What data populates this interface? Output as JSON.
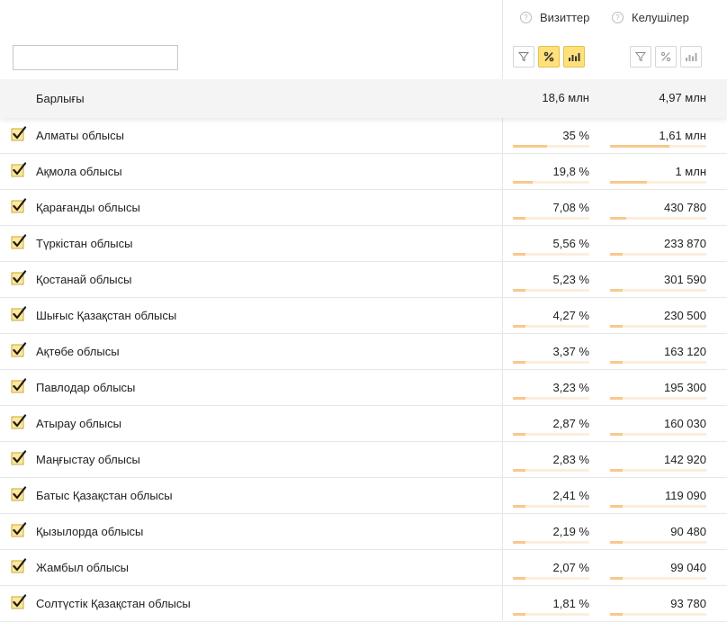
{
  "colors": {
    "accent": "#ffe07a",
    "bar": "#f7c98c",
    "bar_track": "#fbeedc",
    "check": "#1a1a1a",
    "check_bg": "#ffe89a"
  },
  "header": {
    "search_placeholder": "",
    "columns": [
      {
        "label": "Визиттер",
        "help_icon": "help-icon"
      },
      {
        "label": "Келушілер",
        "help_icon": "help-icon"
      }
    ],
    "buttons": {
      "visits": {
        "filter_active": false,
        "percent_active": true,
        "bars_active": true
      },
      "users": {
        "filter_active": false,
        "percent_active": false,
        "bars_active": false
      }
    }
  },
  "total": {
    "label": "Барлығы",
    "visits": "18,6 млн",
    "users": "4,97 млн"
  },
  "rows": [
    {
      "label": "Алматы облысы",
      "visits": "35 %",
      "users": "1,61 млн",
      "visits_share": 0.35,
      "users_share": 0.324,
      "checked": true
    },
    {
      "label": "Ақмола облысы",
      "visits": "19,8 %",
      "users": "1 млн",
      "visits_share": 0.198,
      "users_share": 0.201,
      "checked": true
    },
    {
      "label": "Қарағанды облысы",
      "visits": "7,08 %",
      "users": "430 780",
      "visits_share": 0.0708,
      "users_share": 0.0867,
      "checked": true
    },
    {
      "label": "Түркістан облысы",
      "visits": "5,56 %",
      "users": "233 870",
      "visits_share": 0.0556,
      "users_share": 0.047,
      "checked": true
    },
    {
      "label": "Қостанай облысы",
      "visits": "5,23 %",
      "users": "301 590",
      "visits_share": 0.0523,
      "users_share": 0.0607,
      "checked": true
    },
    {
      "label": "Шығыс Қазақстан облысы",
      "visits": "4,27 %",
      "users": "230 500",
      "visits_share": 0.0427,
      "users_share": 0.0464,
      "checked": true
    },
    {
      "label": "Ақтөбе облысы",
      "visits": "3,37 %",
      "users": "163 120",
      "visits_share": 0.0337,
      "users_share": 0.0328,
      "checked": true
    },
    {
      "label": "Павлодар облысы",
      "visits": "3,23 %",
      "users": "195 300",
      "visits_share": 0.0323,
      "users_share": 0.0393,
      "checked": true
    },
    {
      "label": "Атырау облысы",
      "visits": "2,87 %",
      "users": "160 030",
      "visits_share": 0.0287,
      "users_share": 0.0322,
      "checked": true
    },
    {
      "label": "Маңғыстау облысы",
      "visits": "2,83 %",
      "users": "142 920",
      "visits_share": 0.0283,
      "users_share": 0.0288,
      "checked": true
    },
    {
      "label": "Батыс Қазақстан облысы",
      "visits": "2,41 %",
      "users": "119 090",
      "visits_share": 0.0241,
      "users_share": 0.024,
      "checked": true
    },
    {
      "label": "Қызылорда облысы",
      "visits": "2,19 %",
      "users": "90 480",
      "visits_share": 0.0219,
      "users_share": 0.0182,
      "checked": true
    },
    {
      "label": "Жамбыл облысы",
      "visits": "2,07 %",
      "users": "99 040",
      "visits_share": 0.0207,
      "users_share": 0.0199,
      "checked": true
    },
    {
      "label": "Солтүстік Қазақстан облысы",
      "visits": "1,81 %",
      "users": "93 780",
      "visits_share": 0.0181,
      "users_share": 0.0189,
      "checked": true
    }
  ]
}
